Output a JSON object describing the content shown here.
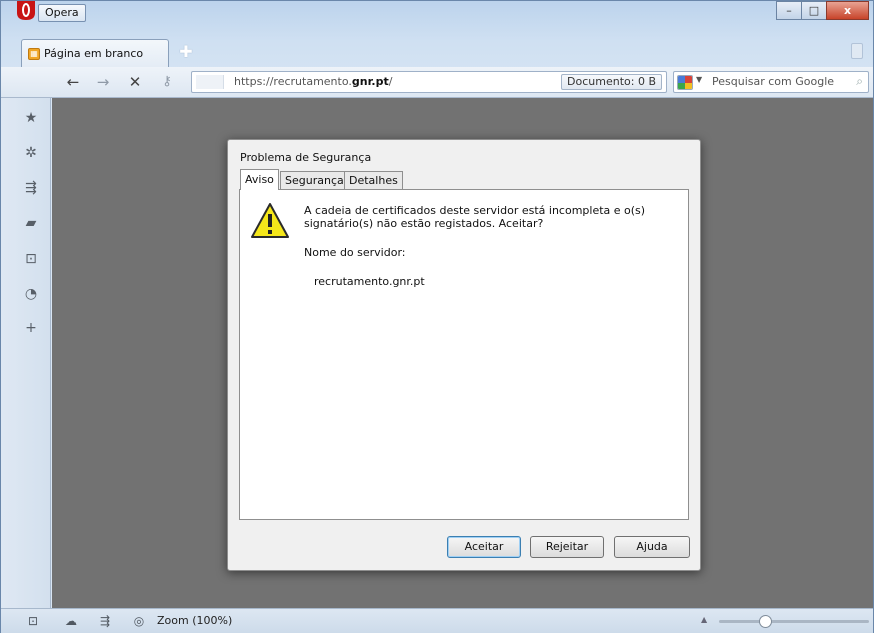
{
  "titlebar": {
    "menu_label": "Opera",
    "minimize": "–",
    "maximize": "□",
    "close": "x"
  },
  "tabs": [
    {
      "label": "Página em branco",
      "icon": "speed-dial-icon"
    }
  ],
  "toolbar": {
    "url_prefix": "https://recrutamento.",
    "url_domain": "gnr.pt",
    "url_suffix": "/",
    "document_size": "Documento:  0 B",
    "search_placeholder": "Pesquisar com Google"
  },
  "side_panel": [
    "bookmarks-icon",
    "settings-icon",
    "unite-icon",
    "notes-icon",
    "downloads-icon",
    "history-icon",
    "add-panel-icon"
  ],
  "dialog": {
    "title": "Problema de Segurança",
    "tabs": [
      "Aviso",
      "Segurança",
      "Detalhes"
    ],
    "active_tab": "Aviso",
    "message": "A cadeia de certificados deste servidor está incompleta e o(s) signatário(s) não estão registados. Aceitar?",
    "server_label": "Nome do servidor:",
    "server_name": "recrutamento.gnr.pt",
    "buttons": {
      "accept": "Aceitar",
      "reject": "Rejeitar",
      "help": "Ajuda"
    }
  },
  "statusbar": {
    "zoom_label": "Zoom (100%)",
    "zoom_level": 1.0
  },
  "colors": {
    "content_bg": "#727272",
    "opera_red": "#cc1b1b",
    "warning_yellow": "#f5e71a"
  }
}
